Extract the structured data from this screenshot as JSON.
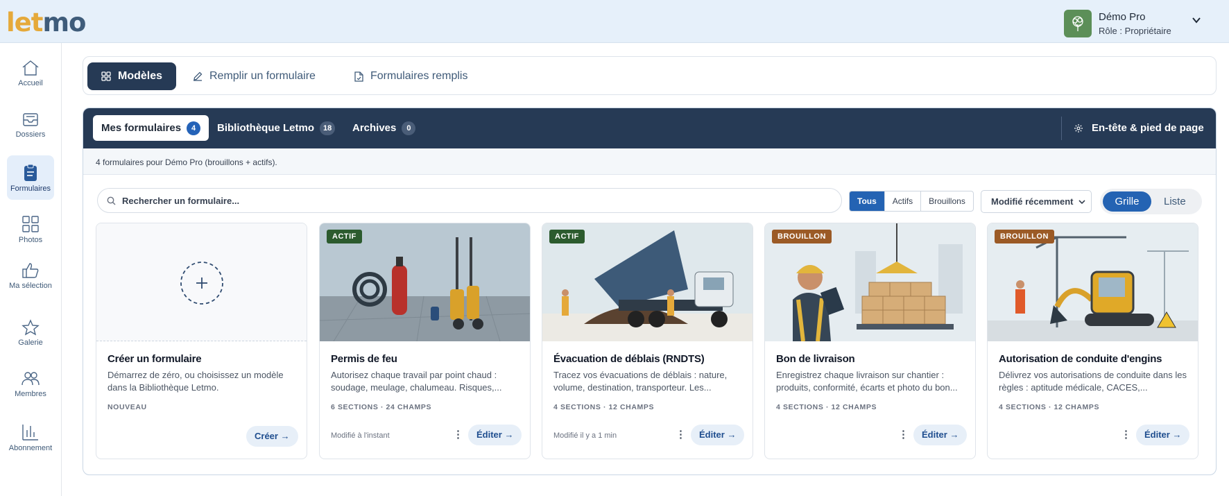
{
  "app": {
    "logo_part1": "let",
    "logo_part2": "mo"
  },
  "user": {
    "name": "Démo Pro",
    "role": "Rôle : Propriétaire"
  },
  "sidebar": {
    "items": [
      {
        "label": "Accueil"
      },
      {
        "label": "Dossiers"
      },
      {
        "label": "Formulaires"
      },
      {
        "label": "Photos"
      },
      {
        "label": "Ma sélection"
      },
      {
        "label": "Galerie"
      },
      {
        "label": "Membres"
      },
      {
        "label": "Abonnement"
      }
    ]
  },
  "main_tabs": [
    {
      "label": "Modèles"
    },
    {
      "label": "Remplir un formulaire"
    },
    {
      "label": "Formulaires remplis"
    }
  ],
  "sub_tabs": [
    {
      "label": "Mes formulaires",
      "count": "4"
    },
    {
      "label": "Bibliothèque Letmo",
      "count": "18"
    },
    {
      "label": "Archives",
      "count": "0"
    }
  ],
  "header_footer_label": "En-tête & pied de page",
  "info": "4 formulaires pour Démo Pro (brouillons + actifs).",
  "search": {
    "placeholder": "Rechercher un formulaire..."
  },
  "filters": [
    "Tous",
    "Actifs",
    "Brouillons"
  ],
  "sort": {
    "selected": "Modifié récemment"
  },
  "view": {
    "grid": "Grille",
    "list": "Liste"
  },
  "new_card": {
    "title": "Créer un formulaire",
    "desc": "Démarrez de zéro, ou choisissez un modèle dans la Bibliothèque Letmo.",
    "tag": "NOUVEAU",
    "button": "Créer →"
  },
  "cards": [
    {
      "status": "ACTIF",
      "title": "Permis de feu",
      "desc": "Autorisez chaque travail par point chaud : soudage, meulage, chalumeau. Risques,...",
      "meta": "6 SECTIONS · 24 CHAMPS",
      "modified": "Modifié à l'instant",
      "button": "Éditer →"
    },
    {
      "status": "ACTIF",
      "title": "Évacuation de déblais (RNDTS)",
      "desc": "Tracez vos évacuations de déblais : nature, volume, destination, transporteur. Les...",
      "meta": "4 SECTIONS · 12 CHAMPS",
      "modified": "Modifié il y a 1 min",
      "button": "Éditer →"
    },
    {
      "status": "BROUILLON",
      "title": "Bon de livraison",
      "desc": "Enregistrez chaque livraison sur chantier : produits, conformité, écarts et photo du bon...",
      "meta": "4 SECTIONS · 12 CHAMPS",
      "modified": "",
      "button": "Éditer →"
    },
    {
      "status": "BROUILLON",
      "title": "Autorisation de conduite d'engins",
      "desc": "Délivrez vos autorisations de conduite dans les règles : aptitude médicale, CACES,...",
      "meta": "4 SECTIONS · 12 CHAMPS",
      "modified": "",
      "button": "Éditer →"
    }
  ],
  "colors": {
    "dark": "#263a55",
    "accent": "#2463b3",
    "active_status": "#2c5b2e",
    "draft_status": "#9b5a26",
    "logo_orange": "#e5a93a",
    "logo_blue": "#3f5c7a"
  }
}
